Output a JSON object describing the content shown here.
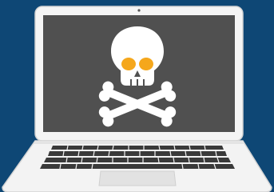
{
  "illustration": {
    "subject": "laptop-with-skull-and-crossbones",
    "icon_name": "skull-crossbones-icon",
    "colors": {
      "background": "#0e4775",
      "laptop_body": "#f5f5f5",
      "laptop_outline": "#d7d7d7",
      "screen": "#505050",
      "keyboard_deck": "#e6e6e6",
      "keys": "#3a3a3a",
      "skull": "#ffffff",
      "eyes": "#f5a71c"
    }
  }
}
